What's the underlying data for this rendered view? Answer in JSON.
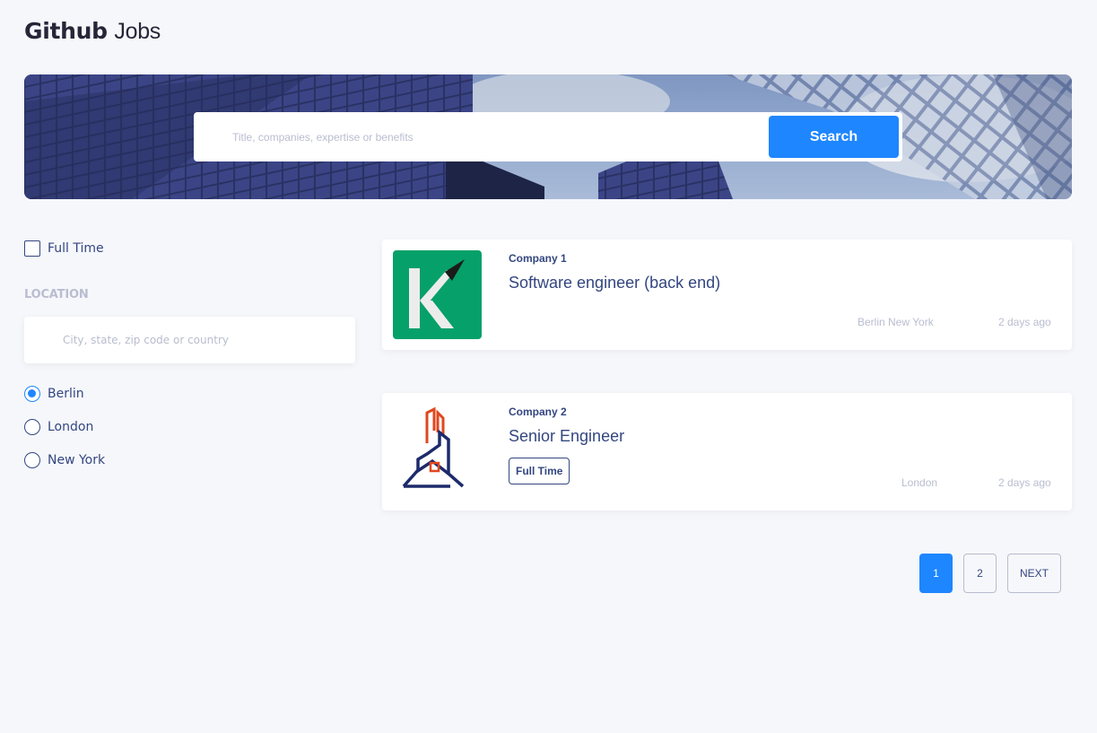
{
  "header": {
    "brand_bold": "Github",
    "brand_light": "Jobs"
  },
  "search": {
    "placeholder": "Title, companies, expertise or benefits",
    "value": "",
    "button_label": "Search"
  },
  "filters": {
    "full_time_label": "Full Time",
    "full_time_checked": false,
    "location_heading": "LOCATION",
    "location_placeholder": "City, state, zip code or country",
    "locations": [
      {
        "label": "Berlin",
        "checked": true
      },
      {
        "label": "London",
        "checked": false
      },
      {
        "label": "New York",
        "checked": false
      }
    ]
  },
  "jobs": [
    {
      "company": "Company 1",
      "title": "Software engineer (back end)",
      "tag": "",
      "locations": "Berlin  New York",
      "posted": "2 days ago",
      "logo": "k-letter-logo"
    },
    {
      "company": "Company 2",
      "title": "Senior Engineer",
      "tag": "Full Time",
      "locations": "London",
      "posted": "2 days ago",
      "logo": "building-house-logo"
    }
  ],
  "pagination": {
    "pages": [
      "1",
      "2"
    ],
    "active": "1",
    "next_label": "NEXT"
  },
  "colors": {
    "accent": "#1e86ff",
    "text": "#334680",
    "muted": "#b9bdcf",
    "background": "#f6f7fb"
  }
}
